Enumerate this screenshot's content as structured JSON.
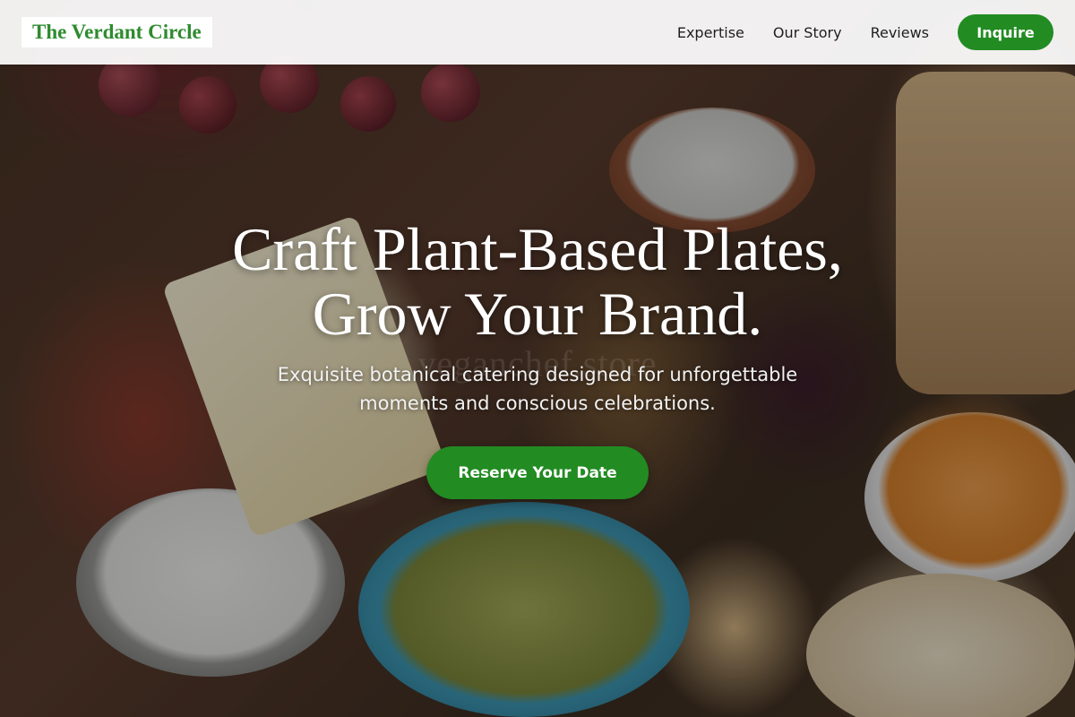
{
  "brand": {
    "name": "The Verdant Circle",
    "accent_color": "#228b22"
  },
  "nav": {
    "links": [
      "Expertise",
      "Our Story",
      "Reviews"
    ],
    "cta_label": "Inquire"
  },
  "hero": {
    "headline_line1": "Craft Plant-Based Plates,",
    "headline_line2": "Grow Your Brand.",
    "subheadline_line1": "Exquisite botanical catering designed for unforgettable",
    "subheadline_line2": "moments and conscious celebrations.",
    "cta_label": "Reserve Your Date",
    "watermark": "veganchef.store"
  }
}
